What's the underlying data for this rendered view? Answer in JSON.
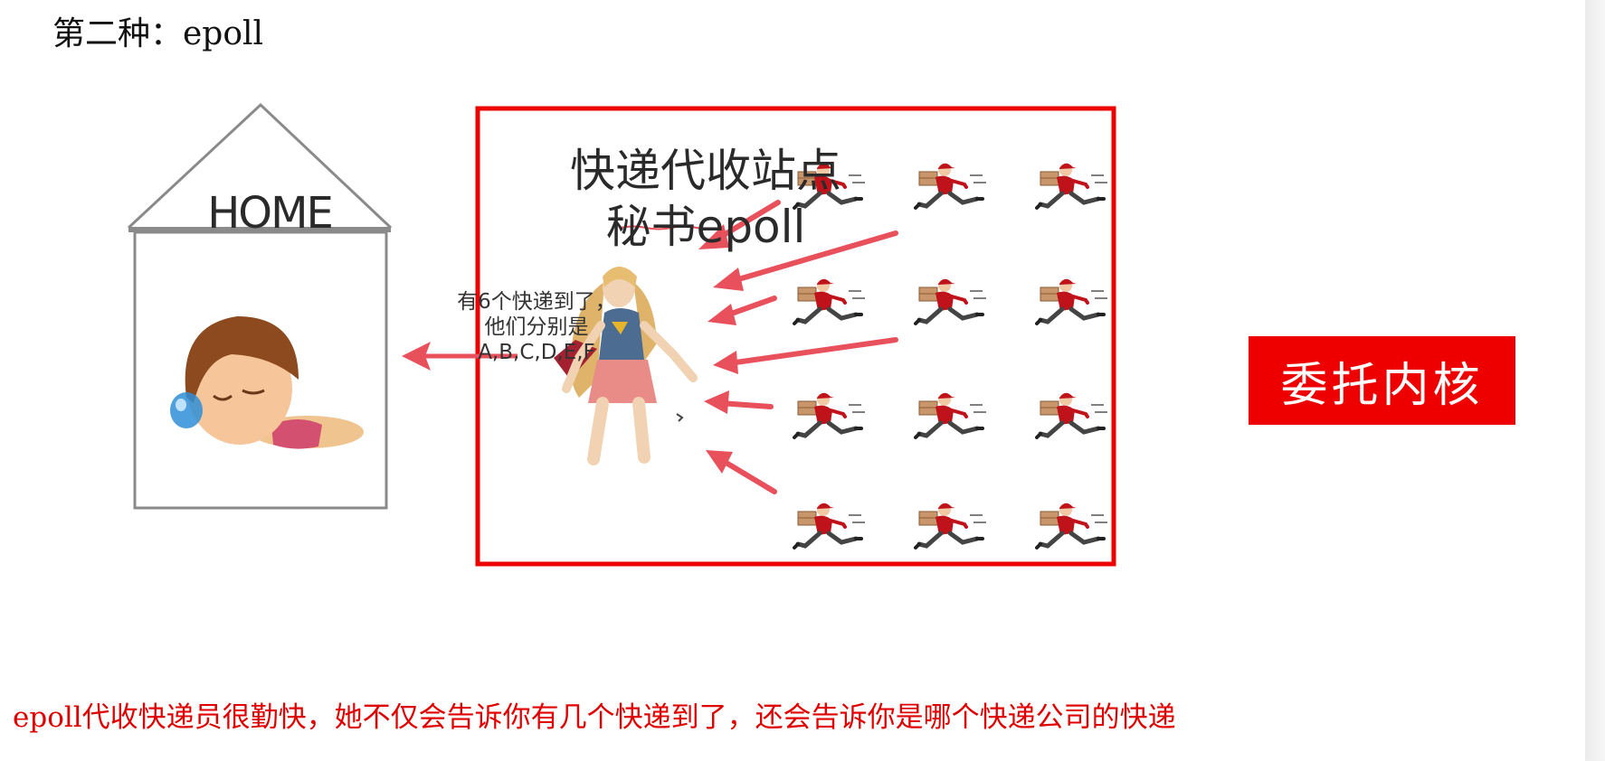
{
  "heading": "第二种：epoll",
  "house": {
    "label": "HOME"
  },
  "station": {
    "title_line1": "快递代收站点",
    "title_line2": "秘书epoll"
  },
  "notification": {
    "line1": "有6个快递到了，",
    "line2": "他们分别是",
    "line3": "A,B,C,D,E,F"
  },
  "badge": {
    "label": "委托内核"
  },
  "caption": "epoll代收快递员很勤快，她不仅会告诉你有几个快递到了，还会告诉你是哪个快递公司的快递",
  "colors": {
    "accent_red": "#ee0000",
    "arrow_red": "#e8505b",
    "house_line": "#8a8a8a",
    "caption_red": "#e00000"
  },
  "icons": {
    "sleeper": "sleeping-person-icon",
    "secretary": "superheroine-icon",
    "courier": "running-courier-icon"
  }
}
